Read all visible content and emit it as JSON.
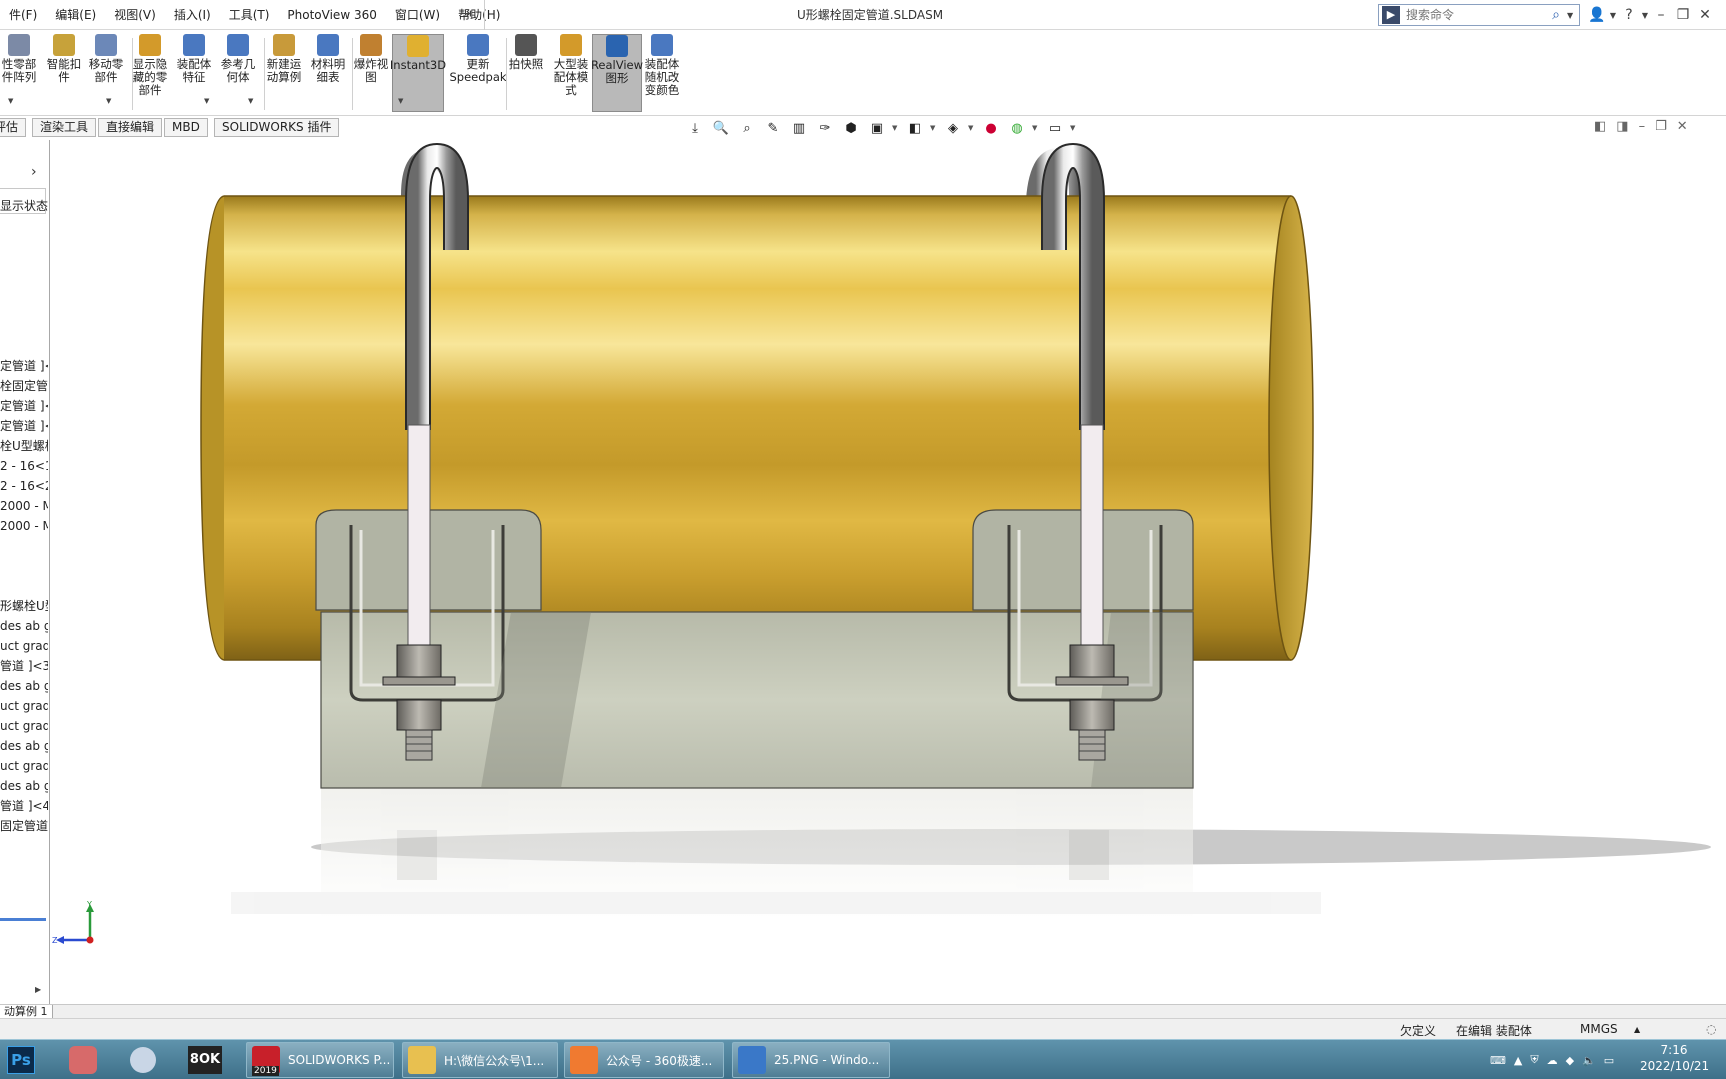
{
  "menubar": {
    "menus": [
      "件(F)",
      "编辑(E)",
      "视图(V)",
      "插入(I)",
      "工具(T)",
      "PhotoView 360",
      "窗口(W)",
      "帮助(H)"
    ],
    "pin_icon": "pin-icon",
    "doc_title": "U形螺栓固定管道.SLDASM",
    "search_placeholder": "搜索命令",
    "window_buttons": [
      "user-icon",
      "help-icon",
      "minimize-icon",
      "restore-icon",
      "close-icon"
    ]
  },
  "ribbon": {
    "buttons": [
      {
        "label": "性零部\n件阵列",
        "icon": "pattern-icon"
      },
      {
        "label": "智能扣\n件",
        "icon": "fastener-icon"
      },
      {
        "label": "移动零\n部件",
        "icon": "move-component-icon"
      },
      {
        "label": "显示隐\n藏的零\n部件",
        "icon": "show-hidden-icon"
      },
      {
        "label": "装配体\n特征",
        "icon": "assembly-feature-icon"
      },
      {
        "label": "参考几\n何体",
        "icon": "reference-geometry-icon"
      },
      {
        "label": "新建运\n动算例",
        "icon": "motion-study-icon"
      },
      {
        "label": "材料明\n细表",
        "icon": "bom-icon"
      },
      {
        "label": "爆炸视\n图",
        "icon": "exploded-view-icon"
      },
      {
        "label": "Instant3D",
        "icon": "instant3d-icon"
      },
      {
        "label": "更新\nSpeedpak",
        "icon": "speedpak-icon"
      },
      {
        "label": "拍快照",
        "icon": "snapshot-icon"
      },
      {
        "label": "大型装\n配体模\n式",
        "icon": "large-assembly-icon"
      },
      {
        "label": "RealView\n图形",
        "icon": "realview-icon"
      },
      {
        "label": "装配体\n随机改\n变颜色",
        "icon": "random-color-icon"
      }
    ]
  },
  "tabs": [
    "评估",
    "渲染工具",
    "直接编辑",
    "MBD",
    "SOLIDWORKS 插件"
  ],
  "feature_tree": {
    "display_state": "显示状态",
    "items": [
      "定管道 ]<1",
      "栓固定管道",
      "定管道 ]<",
      "定管道 ]<",
      "栓U型螺栓",
      "2 - 16<1:",
      "2 - 16<2:",
      "2000 - M",
      "2000 - M",
      "形螺栓U型",
      "des ab g",
      "uct grad",
      "管道 ]<3",
      "des ab g",
      "uct grad",
      "uct grad",
      "des ab g",
      "uct grad",
      "des ab g",
      "管道 ]<4",
      "固定管道 ]"
    ]
  },
  "triad": {
    "y": "Y",
    "z": "Z"
  },
  "motion_tab": "动算例 1",
  "status": {
    "definition": "欠定义",
    "editing": "在编辑 装配体",
    "units": "MMGS"
  },
  "taskbar": {
    "apps": [
      {
        "label": "SOLIDWORKS P...",
        "icon": "solidworks-icon"
      },
      {
        "label": "H:\\微信公众号\\1...",
        "icon": "folder-icon"
      },
      {
        "label": "公众号 - 360极速...",
        "icon": "browser-icon"
      },
      {
        "label": "25.PNG - Windo...",
        "icon": "image-viewer-icon"
      }
    ],
    "sw_badge": "2019",
    "time": "7:16",
    "date": "2022/10/21"
  },
  "colors": {
    "brass": "#c9a534",
    "bracket": "#a9ad9e",
    "accent": "#4a7fd4"
  }
}
